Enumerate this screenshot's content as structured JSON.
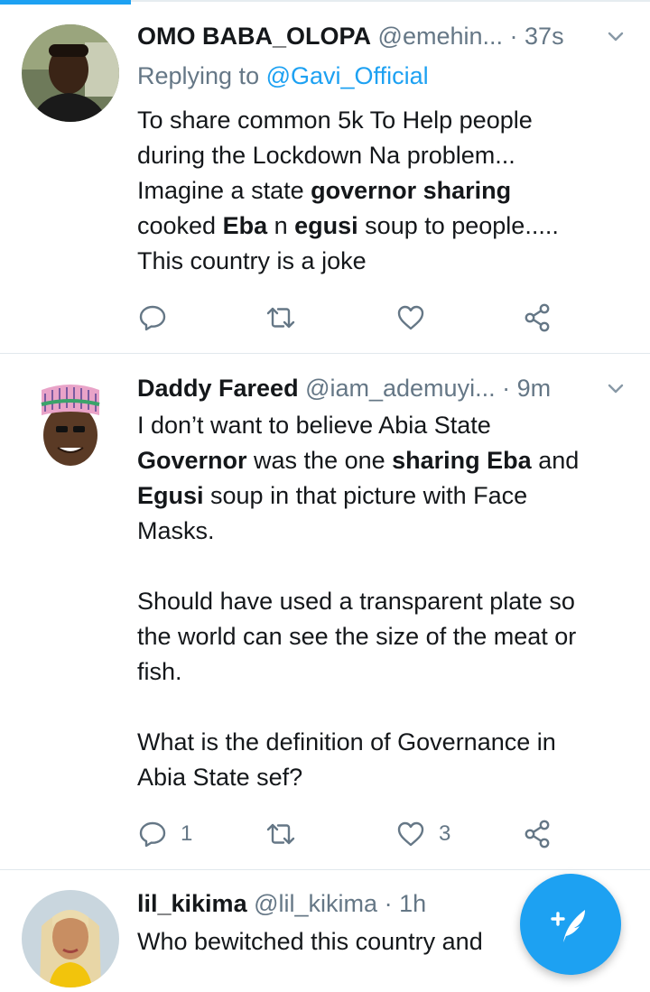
{
  "colors": {
    "accent": "#1da1f2",
    "secondary_text": "#657786",
    "primary_text": "#14171a",
    "divider": "#e1e8ed"
  },
  "tweets": [
    {
      "name": "OMO BABA_OLOPA",
      "handle": "@emehin...",
      "dot": "·",
      "time": "37s",
      "reply_prefix": "Replying to",
      "reply_mention": "@Gavi_Official",
      "body": {
        "line1": "To share common 5k To Help people",
        "line2": "during the Lockdown Na problem...",
        "line3a": "Imagine a state ",
        "line3b": "governor sharing",
        "line4a": "cooked ",
        "line4b": "Eba",
        "line4c": " n ",
        "line4d": "egusi",
        "line4e": " soup to people.....",
        "line5": "This country is a joke"
      },
      "reply_count": "",
      "retweet_count": "",
      "like_count": ""
    },
    {
      "name": "Daddy Fareed",
      "handle": "@iam_ademuyi...",
      "dot": "·",
      "time": "9m",
      "body": {
        "l1": "I don’t want to believe Abia State",
        "l2a": "Governor",
        "l2b": " was the one ",
        "l2c": "sharing Eba",
        "l2d": " and",
        "l3a": "Egusi",
        "l3b": " soup in that picture with Face",
        "l4": "Masks.",
        "l5": "Should have used a transparent plate  so",
        "l6": "the world can see the size of the meat or",
        "l7": "fish.",
        "l8": "What is the definition of Governance in",
        "l9": "Abia State sef?"
      },
      "reply_count": "1",
      "retweet_count": "",
      "like_count": "3"
    },
    {
      "name": "lil_kikima",
      "handle": "@lil_kikima",
      "dot": "·",
      "time": "1h",
      "body": {
        "l1": "Who bewitched this country and"
      }
    }
  ],
  "icons": {
    "reply": "reply-icon",
    "retweet": "retweet-icon",
    "like": "heart-icon",
    "share": "share-icon",
    "more": "chevron-down-icon",
    "compose": "compose-tweet-icon"
  }
}
